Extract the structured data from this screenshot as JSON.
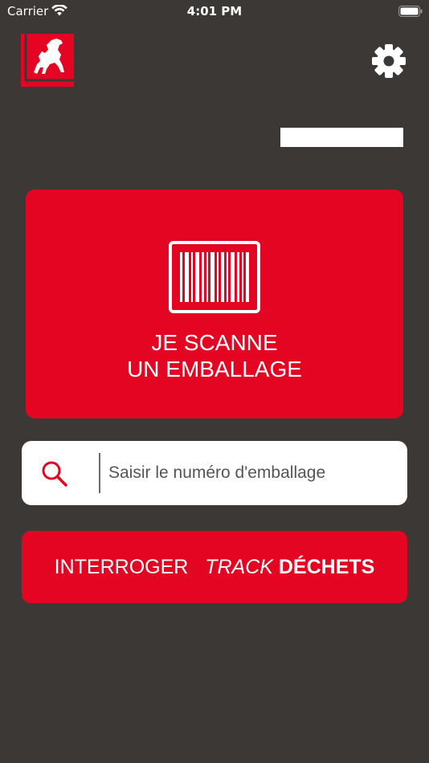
{
  "status_bar": {
    "carrier": "Carrier",
    "time": "4:01 PM"
  },
  "header": {
    "logo_icon": "horse-logo-icon",
    "settings_icon": "gear-icon"
  },
  "scan_button": {
    "icon": "barcode-icon",
    "line1": "JE SCANNE",
    "line2": "UN EMBALLAGE"
  },
  "search": {
    "icon": "search-icon",
    "placeholder": "Saisir le numéro d'emballage",
    "value": ""
  },
  "track_button": {
    "part1": "INTERROGER",
    "part2": "TRACK",
    "part3": "DÉCHETS"
  },
  "colors": {
    "background": "#3c3835",
    "accent": "#e30521",
    "white": "#ffffff"
  }
}
